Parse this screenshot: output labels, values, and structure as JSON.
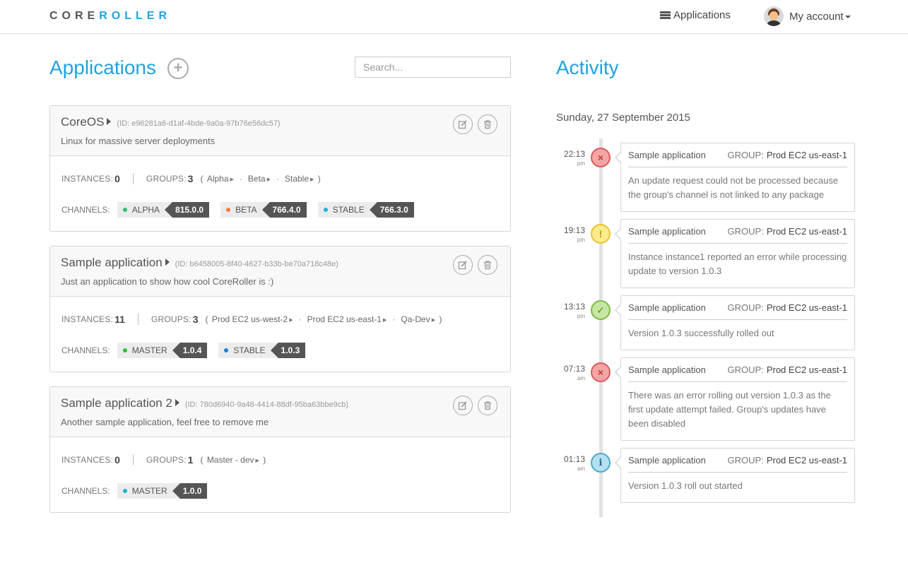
{
  "nav": {
    "brand_core": "CORE",
    "brand_roller": "ROLLER",
    "applications_label": "Applications",
    "account_label": "My account"
  },
  "left": {
    "title": "Applications",
    "add_symbol": "+",
    "search_placeholder": "Search...",
    "instances_label": "INSTANCES:",
    "groups_label": "GROUPS:",
    "channels_label": "CHANNELS:"
  },
  "apps": [
    {
      "name": "CoreOS",
      "id": "(ID: e96281a6-d1af-4bde-9a0a-97b76e56dc57)",
      "description": "Linux for massive server deployments",
      "instances": "0",
      "groups_count": "3",
      "groups": [
        "Alpha",
        "Beta",
        "Stable"
      ],
      "channels": [
        {
          "name": "ALPHA",
          "version": "815.0.0",
          "color": "#2fbf71"
        },
        {
          "name": "BETA",
          "version": "766.4.0",
          "color": "#f07c3a"
        },
        {
          "name": "STABLE",
          "version": "766.3.0",
          "color": "#1fb3e0"
        }
      ]
    },
    {
      "name": "Sample application",
      "id": "(ID: b6458005-8f40-4627-b33b-be70a718c48e)",
      "description": "Just an application to show how cool CoreRoller is :)",
      "instances": "11",
      "groups_count": "3",
      "groups": [
        "Prod EC2 us-west-2",
        "Prod EC2 us-east-1",
        "Qa-Dev"
      ],
      "channels": [
        {
          "name": "MASTER",
          "version": "1.0.4",
          "color": "#27c23a"
        },
        {
          "name": "STABLE",
          "version": "1.0.3",
          "color": "#1f7fe0"
        }
      ]
    },
    {
      "name": "Sample application 2",
      "id": "(ID: 780d6940-9a48-4414-88df-95ba63bbe9cb)",
      "description": "Another sample application, feel free to remove me",
      "instances": "0",
      "groups_count": "1",
      "groups": [
        "Master - dev"
      ],
      "channels": [
        {
          "name": "MASTER",
          "version": "1.0.0",
          "color": "#1fb3c8"
        }
      ]
    }
  ],
  "activity": {
    "title": "Activity",
    "date": "Sunday, 27 September 2015",
    "group_label": "GROUP:",
    "events": [
      {
        "time": "22:13",
        "ampm": "pm",
        "status": "err",
        "icon": "×",
        "app": "Sample application",
        "group": "Prod EC2 us-east-1",
        "text": "An update request could not be processed because the group's channel is not linked to any package"
      },
      {
        "time": "19:13",
        "ampm": "pm",
        "status": "warn",
        "icon": "!",
        "app": "Sample application",
        "group": "Prod EC2 us-east-1",
        "text": "Instance instance1 reported an error while processing update to version 1.0.3"
      },
      {
        "time": "13:13",
        "ampm": "pm",
        "status": "ok",
        "icon": "✓",
        "app": "Sample application",
        "group": "Prod EC2 us-east-1",
        "text": "Version 1.0.3 successfully rolled out"
      },
      {
        "time": "07:13",
        "ampm": "am",
        "status": "err",
        "icon": "×",
        "app": "Sample application",
        "group": "Prod EC2 us-east-1",
        "text": "There was an error rolling out version 1.0.3 as the first update attempt failed. Group's updates have been disabled"
      },
      {
        "time": "01:13",
        "ampm": "am",
        "status": "info",
        "icon": "i",
        "app": "Sample application",
        "group": "Prod EC2 us-east-1",
        "text": "Version 1.0.3 roll out started"
      }
    ]
  }
}
